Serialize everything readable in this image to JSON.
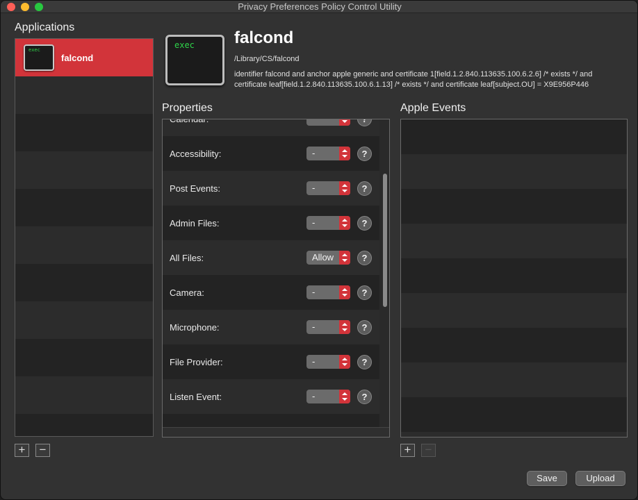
{
  "window": {
    "title": "Privacy Preferences Policy Control Utility"
  },
  "applications": {
    "heading": "Applications",
    "items": [
      {
        "name": "falcond",
        "icon_text": "exec",
        "selected": true
      }
    ],
    "add_label": "+",
    "remove_label": "−"
  },
  "app_info": {
    "icon_text": "exec",
    "name": "falcond",
    "path": "/Library/CS/falcond",
    "requirement": "identifier falcond and anchor apple generic and certificate 1[field.1.2.840.113635.100.6.2.6] /* exists */ and certificate leaf[field.1.2.840.113635.100.6.1.13] /* exists */ and certificate leaf[subject.OU] = X9E956P446"
  },
  "properties": {
    "heading": "Properties",
    "rows": [
      {
        "label": "Calendar:",
        "value": "-"
      },
      {
        "label": "Accessibility:",
        "value": "-"
      },
      {
        "label": "Post Events:",
        "value": "-"
      },
      {
        "label": "Admin Files:",
        "value": "-"
      },
      {
        "label": "All Files:",
        "value": "Allow"
      },
      {
        "label": "Camera:",
        "value": "-"
      },
      {
        "label": "Microphone:",
        "value": "-"
      },
      {
        "label": "File Provider:",
        "value": "-"
      },
      {
        "label": "Listen Event:",
        "value": "-"
      }
    ],
    "help_label": "?"
  },
  "apple_events": {
    "heading": "Apple Events",
    "add_label": "+",
    "remove_label": "−"
  },
  "footer": {
    "save_label": "Save",
    "upload_label": "Upload"
  },
  "colors": {
    "accent": "#d2343a",
    "exec_green": "#2fd44a"
  }
}
